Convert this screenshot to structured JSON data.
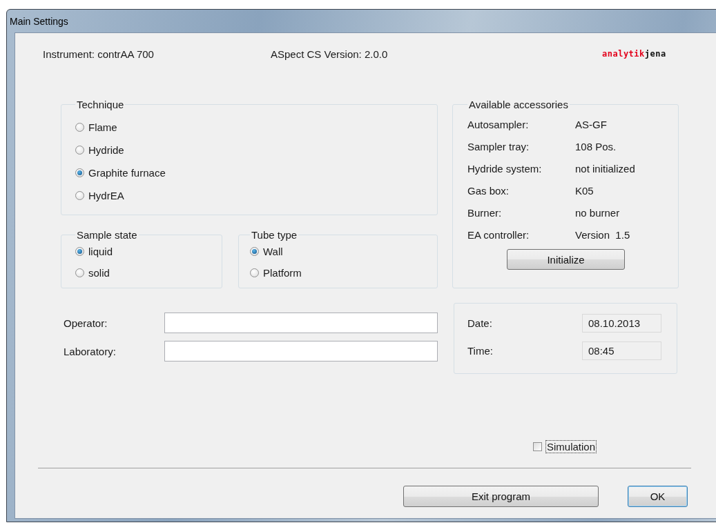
{
  "window": {
    "title": "Main Settings"
  },
  "header": {
    "instrument": "Instrument: contrAA 700",
    "version": "ASpect CS Version: 2.0.0",
    "logo": {
      "part_1": "analytik",
      "part_2": "jena"
    }
  },
  "technique": {
    "title": "Technique",
    "options": [
      {
        "label": "Flame",
        "selected": false
      },
      {
        "label": "Hydride",
        "selected": false
      },
      {
        "label": "Graphite furnace",
        "selected": true
      },
      {
        "label": "HydrEA",
        "selected": false
      }
    ]
  },
  "sample_state": {
    "title": "Sample state",
    "options": [
      {
        "label": "liquid",
        "selected": true
      },
      {
        "label": "solid",
        "selected": false
      }
    ]
  },
  "tube_type": {
    "title": "Tube type",
    "options": [
      {
        "label": "Wall",
        "selected": true
      },
      {
        "label": "Platform",
        "selected": false
      }
    ]
  },
  "accessories": {
    "title": "Available accessories",
    "rows": [
      {
        "label": "Autosampler:",
        "value": "AS-GF"
      },
      {
        "label": "Sampler tray:",
        "value": "108 Pos."
      },
      {
        "label": "Hydride system:",
        "value": "not initialized"
      },
      {
        "label": "Gas box:",
        "value": "K05"
      },
      {
        "label": "Burner:",
        "value": "no burner"
      },
      {
        "label": "EA controller:",
        "value": "Version  1.5"
      }
    ],
    "button": "Initialize"
  },
  "fields": [
    {
      "label": "Operator:"
    },
    {
      "label": "Laboratory:"
    }
  ],
  "date_time": [
    {
      "label": "Date:",
      "value": "08.10.2013"
    },
    {
      "label": "Time:",
      "value": "08:45"
    }
  ],
  "simulation": {
    "label": "Simulation",
    "checked": false
  },
  "buttons": [
    {
      "label": "Exit program",
      "kind": "normal"
    },
    {
      "label": "OK",
      "kind": "default"
    }
  ]
}
